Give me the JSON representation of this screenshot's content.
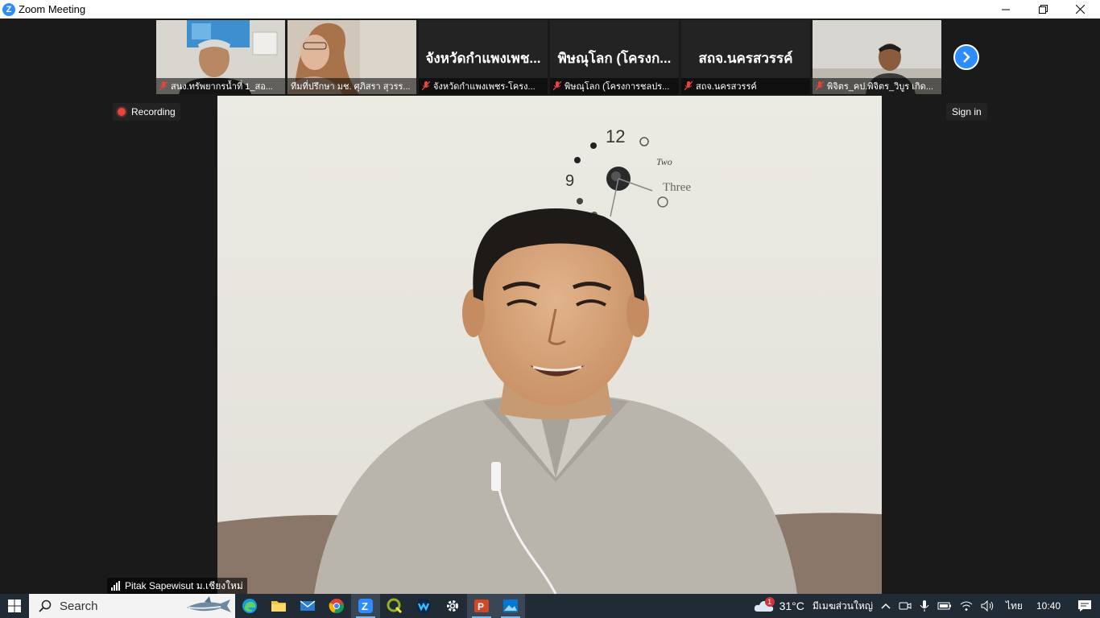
{
  "window": {
    "app_icon": "zoom-logo-icon",
    "title": "Zoom Meeting",
    "controls": [
      "minimize-icon",
      "restore-icon",
      "close-icon"
    ]
  },
  "gallery": {
    "tiles": [
      {
        "name": "สนง.ทรัพยากรน้ำที่ 1_สอ...",
        "muted": true,
        "video": true
      },
      {
        "name": "ทีมที่ปรึกษา มช. ศุภิสรา สุวรร...",
        "muted": false,
        "video": true
      },
      {
        "name": "จังหวัดกำแพงเพชร-โครง...",
        "display_name": "จังหวัดกำแพงเพช...",
        "muted": true,
        "video": false
      },
      {
        "name": "พิษณุโลก (โครงการชลปร...",
        "display_name": "พิษณุโลก (โครงก...",
        "muted": true,
        "video": false
      },
      {
        "name": "สถจ.นครสวรรค์",
        "display_name": "สถจ.นครสวรรค์",
        "muted": true,
        "video": false
      },
      {
        "name": "พิจิตร_คป.พิจิตร_วิบูร เกิด...",
        "muted": true,
        "video": true
      }
    ],
    "next_icon": "chevron-right-icon"
  },
  "status": {
    "recording_label": "Recording",
    "signin_label": "Sign in"
  },
  "active_speaker": {
    "name": "Pitak Sapewisut ม.เชียงใหม่",
    "clock_labels": {
      "twelve": "12",
      "nine": "9",
      "two": "Two",
      "three": "Three"
    }
  },
  "taskbar": {
    "search_placeholder": "Search",
    "apps": [
      "edge-icon",
      "file-explorer-icon",
      "mail-icon",
      "chrome-icon",
      "zoom-icon",
      "qgis-icon",
      "webex-icon",
      "settings-icon",
      "powerpoint-icon",
      "photos-icon"
    ],
    "weather_temp": "31°C",
    "weather_desc": "มีเมฆส่วนใหญ่",
    "weather_badge": "1",
    "language": "ไทย",
    "time": "10:40"
  },
  "colors": {
    "zoom_blue": "#2D8CFF",
    "record_red": "#e8453c",
    "taskbar_bg": "#202b36"
  }
}
